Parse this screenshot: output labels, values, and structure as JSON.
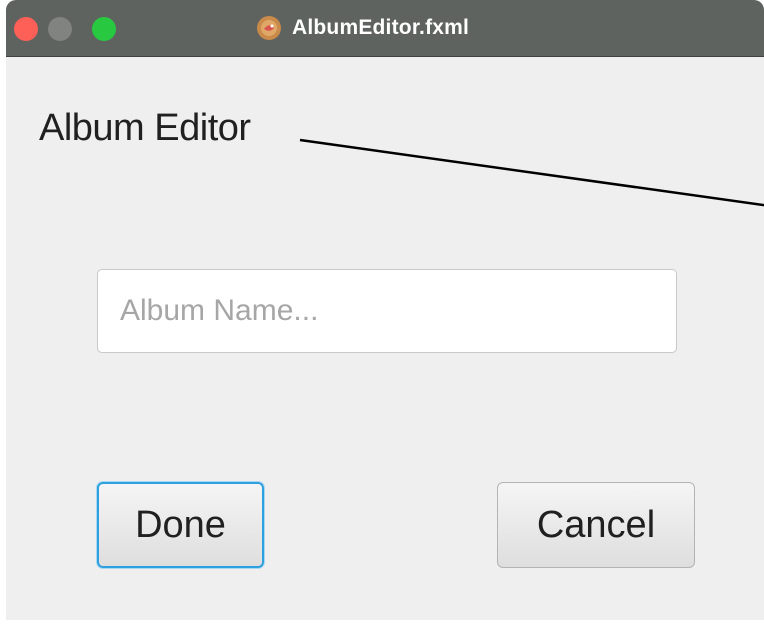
{
  "window": {
    "title": "AlbumEditor.fxml",
    "app_icon": "javafx-scene-builder-icon",
    "controls": [
      "close",
      "minimize",
      "zoom"
    ]
  },
  "main": {
    "heading": "Album Editor",
    "album_name_input": {
      "value": "",
      "placeholder": "Album Name..."
    },
    "done_label": "Done",
    "cancel_label": "Cancel"
  },
  "colors": {
    "titlebar": "#5e635f",
    "background": "#efefef",
    "close": "#fe5f57",
    "minimize": "#80837f",
    "zoom": "#28c840",
    "focus_border": "#2ea0df"
  }
}
